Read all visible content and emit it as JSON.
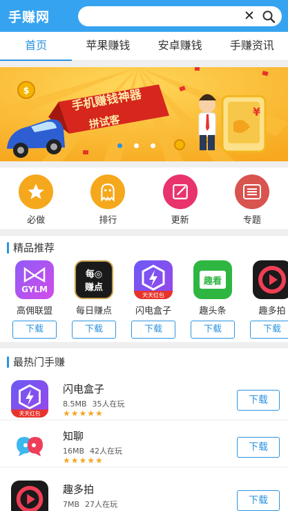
{
  "header": {
    "logo": "手赚网",
    "search": {
      "value": "",
      "placeholder": ""
    }
  },
  "tabs": [
    {
      "label": "首页",
      "active": true
    },
    {
      "label": "苹果赚钱",
      "active": false
    },
    {
      "label": "安卓赚钱",
      "active": false
    },
    {
      "label": "手赚资讯",
      "active": false
    }
  ],
  "banner": {
    "slogan_line1": "手机赚钱神器",
    "slogan_line2": "拼试客",
    "slide_count": 3,
    "current_slide": 1
  },
  "quick_links": [
    {
      "label": "必做",
      "icon": "star-icon",
      "color": "#f5a81c"
    },
    {
      "label": "排行",
      "icon": "ghost-icon",
      "color": "#f5a81c"
    },
    {
      "label": "更新",
      "icon": "edit-icon",
      "color": "#e8336d"
    },
    {
      "label": "专题",
      "icon": "list-icon",
      "color": "#d9534f"
    }
  ],
  "recommend": {
    "title": "精品推荐",
    "download_label": "下载",
    "apps": [
      {
        "name": "高佣联盟",
        "icon_text": "GYLM"
      },
      {
        "name": "每日赚点",
        "icon_text": "每日赚点"
      },
      {
        "name": "闪电盒子",
        "icon_text": "天天红包"
      },
      {
        "name": "趣头条",
        "icon_text": "趣看"
      },
      {
        "name": "趣多拍",
        "icon_text": ""
      }
    ]
  },
  "hot": {
    "title": "最热门手赚",
    "download_label": "下载",
    "apps": [
      {
        "name": "闪电盒子",
        "size": "8.5MB",
        "players": "35人在玩",
        "stars": "★★★★★",
        "icon_text": "天天红包"
      },
      {
        "name": "知聊",
        "size": "16MB",
        "players": "42人在玩",
        "stars": "★★★★★",
        "icon_text": ""
      },
      {
        "name": "趣多拍",
        "size": "7MB",
        "players": "27人在玩",
        "stars": "★★★★★",
        "icon_text": ""
      }
    ]
  }
}
